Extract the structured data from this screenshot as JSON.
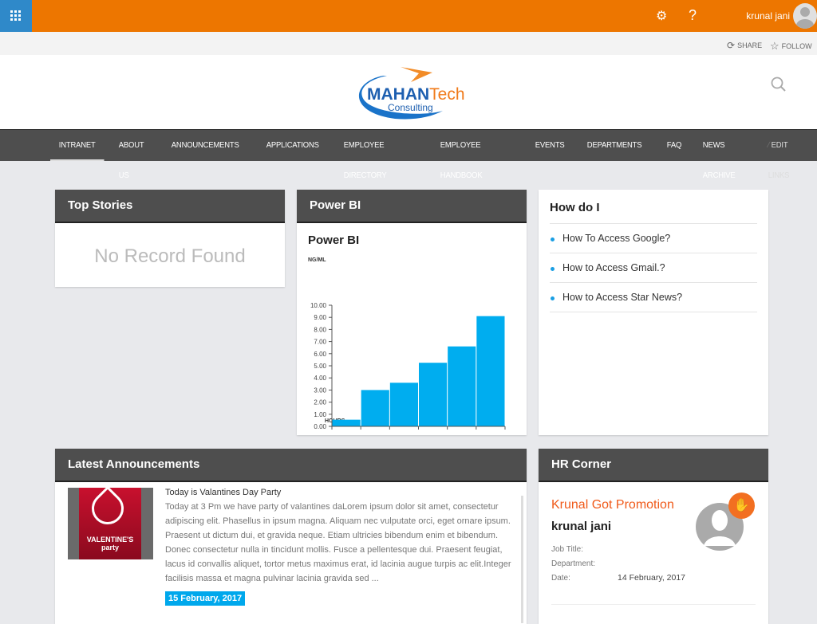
{
  "topbar": {
    "user": "krunal jani",
    "icons": [
      "app-launcher-icon",
      "gear-icon",
      "help-icon",
      "avatar"
    ]
  },
  "actions": {
    "share": "SHARE",
    "follow": "FOLLOW"
  },
  "logo": {
    "line1a": "MAHAN",
    "line1b": "Tech",
    "line2": "Consulting"
  },
  "nav": [
    "INTRANET",
    "ABOUT US",
    "ANNOUNCEMENTS",
    "APPLICATIONS",
    "EMPLOYEE DIRECTORY",
    "EMPLOYEE HANDBOOK",
    "EVENTS",
    "DEPARTMENTS",
    "FAQ",
    "NEWS ARCHIVE"
  ],
  "nav_edit": "EDIT LINKS",
  "top_stories": {
    "title": "Top Stories",
    "empty": "No Record Found"
  },
  "powerbi": {
    "header": "Power BI",
    "title": "Power BI"
  },
  "chart_data": {
    "type": "bar",
    "ylabel": "NG/ML",
    "xlabel": "HOURS",
    "xlim": [
      0,
      30
    ],
    "ylim": [
      0,
      10
    ],
    "xticks": [
      "0.00",
      "5.00",
      "10.00",
      "15.00",
      "20.00",
      "25.00",
      "30.00"
    ],
    "yticks": [
      "0.00",
      "1.00",
      "2.00",
      "3.00",
      "4.00",
      "5.00",
      "6.00",
      "7.00",
      "8.00",
      "9.00",
      "10.00"
    ],
    "bins": [
      [
        0,
        5
      ],
      [
        5,
        10
      ],
      [
        10,
        15
      ],
      [
        15,
        20
      ],
      [
        20,
        25
      ],
      [
        25,
        30
      ]
    ],
    "values": [
      0.55,
      3.0,
      3.6,
      5.25,
      6.6,
      9.1
    ],
    "color": "#00adef"
  },
  "howdo": {
    "title": "How do I",
    "items": [
      "How To Access Google?",
      "How to Access Gmail.?",
      "How to Access Star News?"
    ]
  },
  "announcements": {
    "title": "Latest Announcements",
    "items": [
      {
        "title": "Today is Valantines Day Party",
        "body": "Today at 3 Pm we have party of valantines daLorem ipsum dolor sit amet, consectetur adipiscing elit. Phasellus in ipsum magna. Aliquam nec vulputate orci, eget ornare ipsum. Praesent ut dictum dui, et gravida neque. Etiam ultricies bibendum enim et bibendum. Donec consectetur nulla in tincidunt mollis. Fusce a pellentesque dui. Praesent feugiat, lacus id convallis aliquet, tortor metus maximus erat, id lacinia augue turpis ac elit.Integer facilisis massa et magna pulvinar lacinia gravida sed ...",
        "date": "15 February, 2017",
        "image_text": "VALENTINE'S party"
      }
    ]
  },
  "hr": {
    "title": "HR Corner",
    "headline": "Krunal Got Promotion",
    "name": "krunal jani",
    "job_label": "Job Title:",
    "dept_label": "Department:",
    "date_label": "Date:",
    "date": "14 February, 2017"
  }
}
